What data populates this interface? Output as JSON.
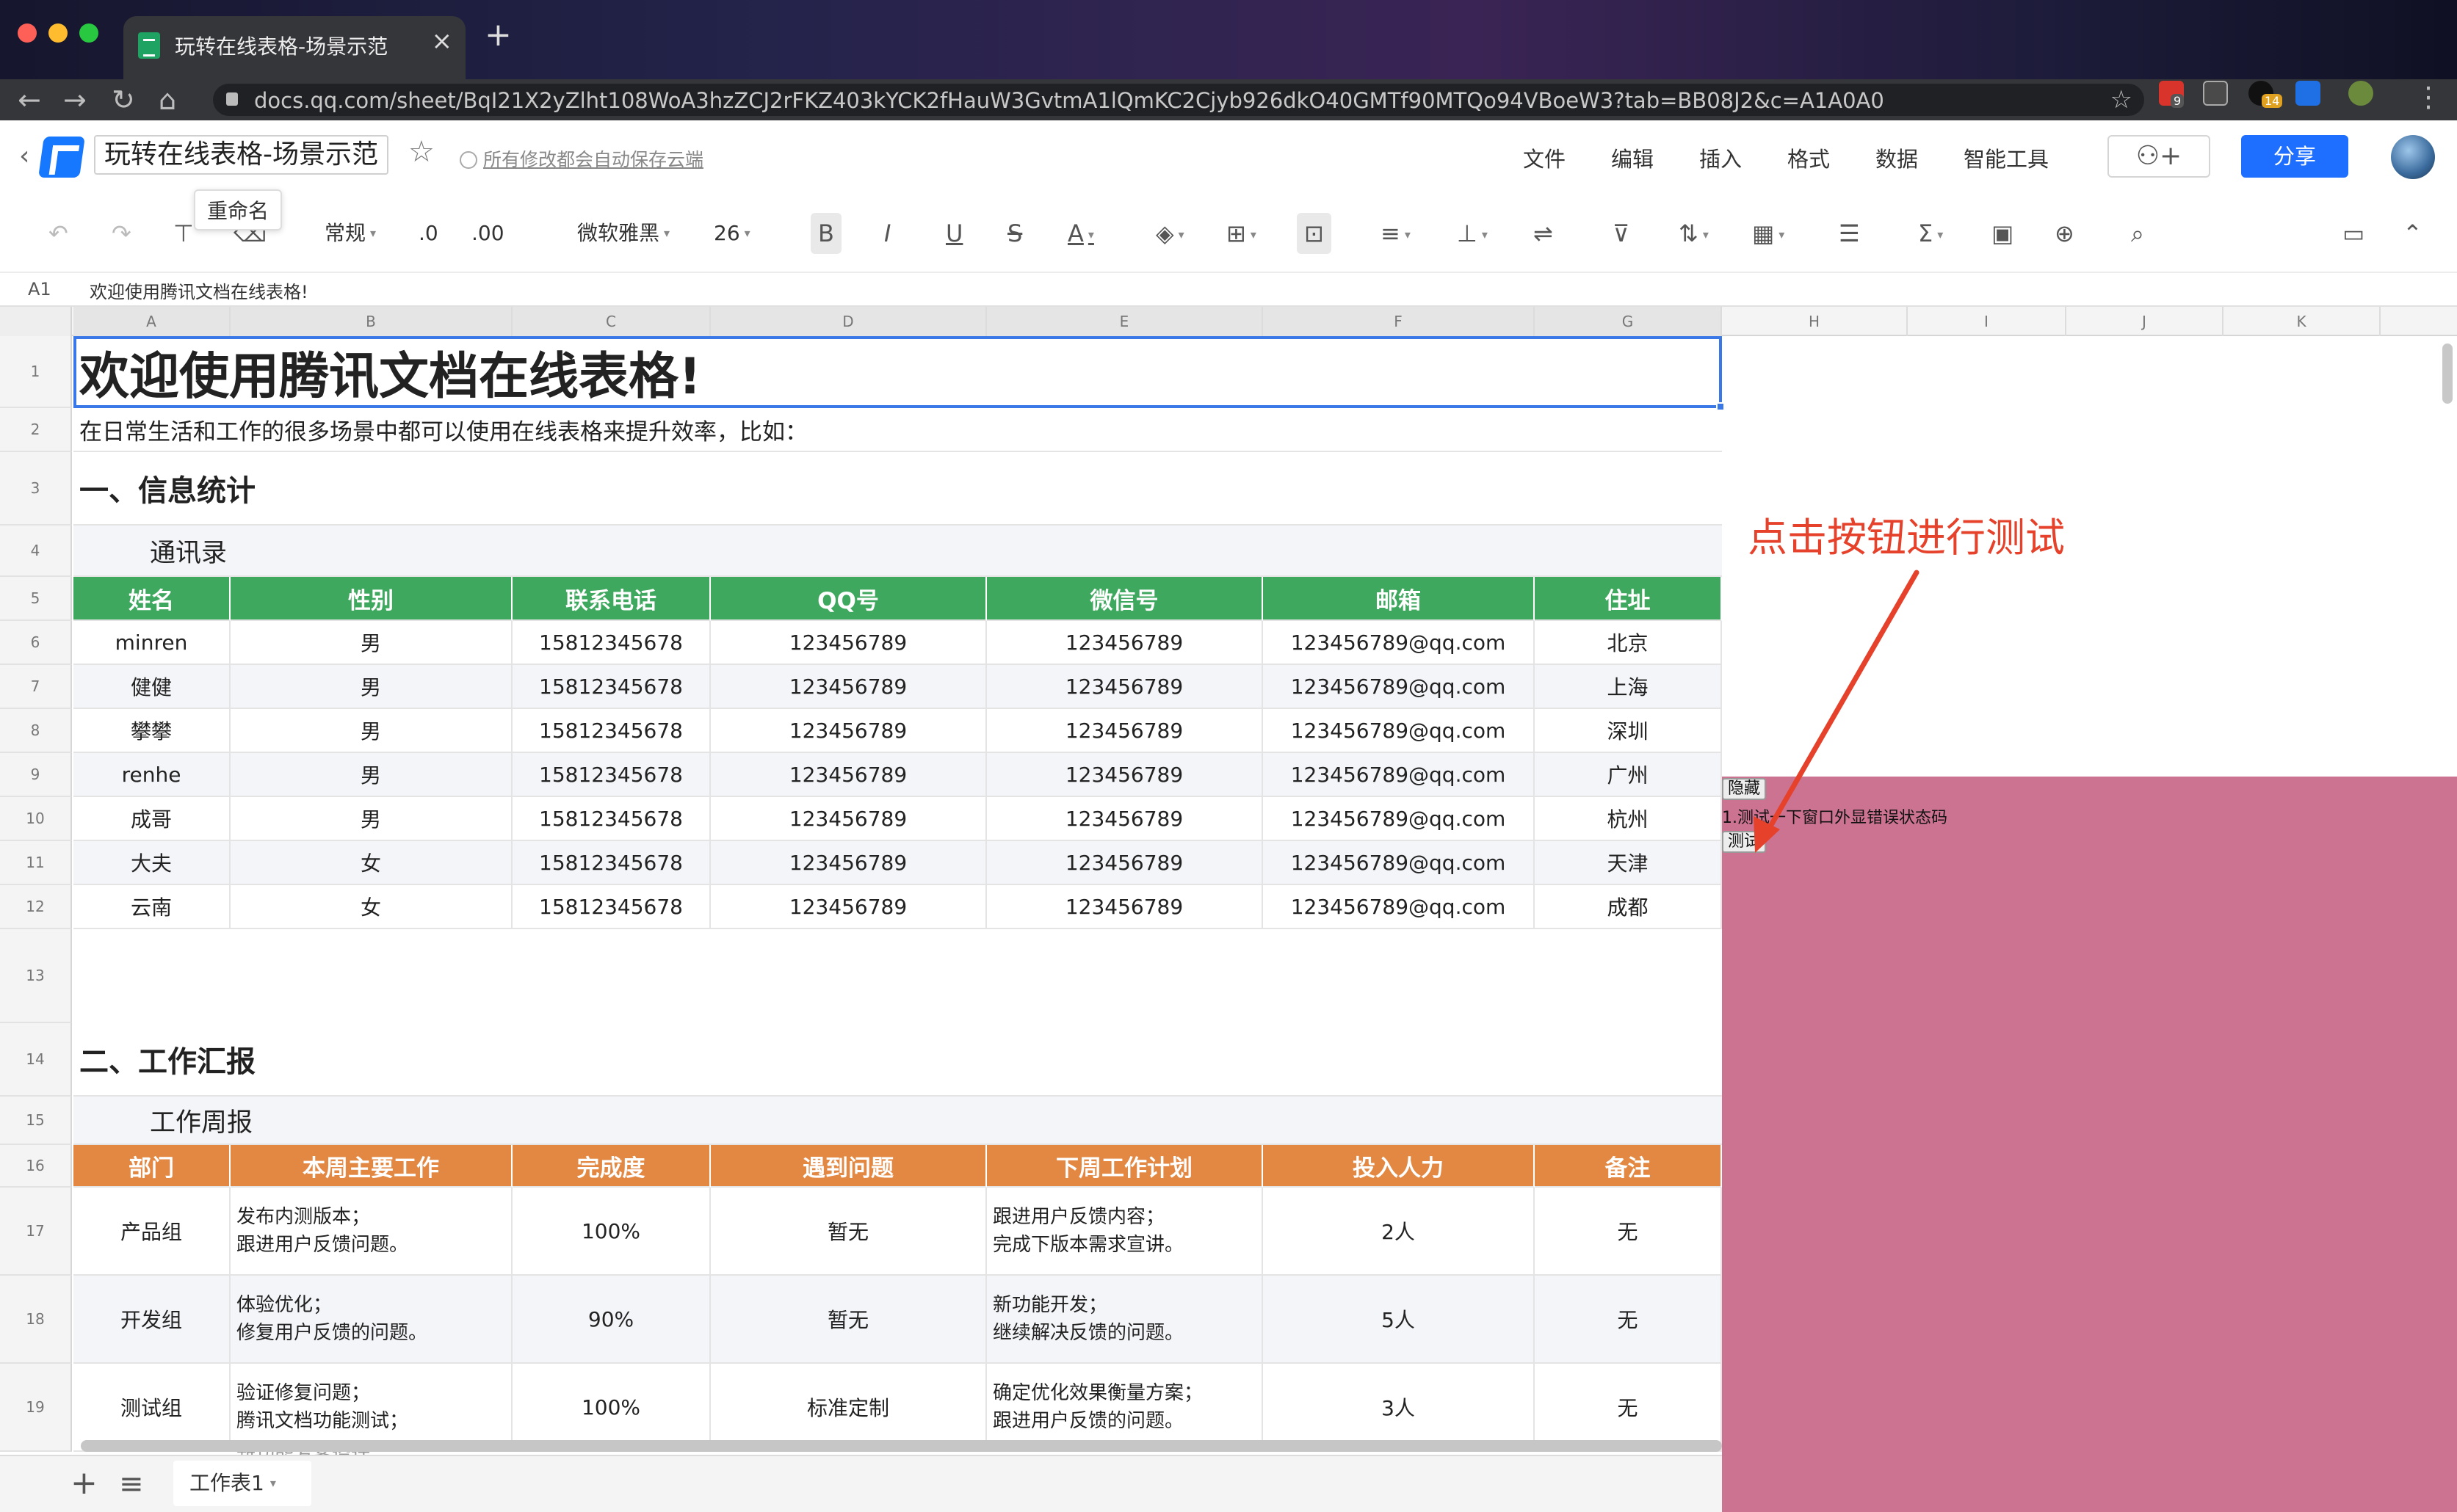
{
  "browser": {
    "tab_title": "玩转在线表格-场景示范",
    "new_tab": "+",
    "url": "docs.qq.com/sheet/BqI21X2yZlht108WoA3hzZCJ2rFKZ403kYCK2fHauW3GvtmA1lQmKC2Cjyb926dkO40GMTf90MTQo94VBoeW3?tab=BB08J2&c=A1A0A0",
    "ext_badges": [
      "9",
      "14"
    ]
  },
  "app": {
    "doc_title": "玩转在线表格-场景示范",
    "save_status": "所有修改都会自动保存云端",
    "tooltip": "重命名",
    "menu": [
      "文件",
      "编辑",
      "插入",
      "格式",
      "数据",
      "智能工具"
    ],
    "share": "分享"
  },
  "toolbar": {
    "number_format": "常规",
    "decrease_decimal": ".0",
    "increase_decimal": ".00",
    "font_family": "微软雅黑",
    "font_size": "26",
    "bold": "B",
    "italic": "I",
    "underline": "U",
    "strike": "S",
    "font_color": "A",
    "sum": "Σ"
  },
  "formula_bar": {
    "cell_ref": "A1",
    "content": "欢迎使用腾讯文档在线表格!"
  },
  "columns": [
    "A",
    "B",
    "C",
    "D",
    "E",
    "F",
    "G",
    "H",
    "I",
    "J",
    "K"
  ],
  "rows": [
    "1",
    "2",
    "3",
    "4",
    "5",
    "6",
    "7",
    "8",
    "9",
    "10",
    "11",
    "12",
    "13",
    "14",
    "15",
    "16",
    "17",
    "18",
    "19"
  ],
  "sheet": {
    "title": "欢迎使用腾讯文档在线表格!",
    "subtitle": "在日常生活和工作的很多场景中都可以使用在线表格来提升效率，比如：",
    "section1": "一、信息统计",
    "table1_caption": "通讯录",
    "table1_headers": [
      "姓名",
      "性别",
      "联系电话",
      "QQ号",
      "微信号",
      "邮箱",
      "住址"
    ],
    "table1_rows": [
      [
        "minren",
        "男",
        "15812345678",
        "123456789",
        "123456789",
        "123456789@qq.com",
        "北京"
      ],
      [
        "健健",
        "男",
        "15812345678",
        "123456789",
        "123456789",
        "123456789@qq.com",
        "上海"
      ],
      [
        "攀攀",
        "男",
        "15812345678",
        "123456789",
        "123456789",
        "123456789@qq.com",
        "深圳"
      ],
      [
        "renhe",
        "男",
        "15812345678",
        "123456789",
        "123456789",
        "123456789@qq.com",
        "广州"
      ],
      [
        "成哥",
        "男",
        "15812345678",
        "123456789",
        "123456789",
        "123456789@qq.com",
        "杭州"
      ],
      [
        "大夫",
        "女",
        "15812345678",
        "123456789",
        "123456789",
        "123456789@qq.com",
        "天津"
      ],
      [
        "云南",
        "女",
        "15812345678",
        "123456789",
        "123456789",
        "123456789@qq.com",
        "成都"
      ]
    ],
    "section2": "二、工作汇报",
    "table2_caption": "工作周报",
    "table2_headers": [
      "部门",
      "本周主要工作",
      "完成度",
      "遇到问题",
      "下周工作计划",
      "投入人力",
      "备注"
    ],
    "table2_rows": [
      [
        "产品组",
        "发布内测版本；",
        "跟进用户反馈问题。",
        "100%",
        "暂无",
        "跟进用户反馈内容；",
        "完成下版本需求宣讲。",
        "2人",
        "无"
      ],
      [
        "开发组",
        "体验优化；",
        "修复用户反馈的问题。",
        "90%",
        "暂无",
        "新功能开发；",
        "继续解决反馈的问题。",
        "5人",
        "无"
      ],
      [
        "测试组",
        "验证修复问题；",
        "腾讯文档功能测试；",
        "100%",
        "标准定制",
        "确定优化效果衡量方案；",
        "跟进用户反馈的问题。",
        "3人",
        "无"
      ]
    ],
    "partial_row": "新功能方案设计；"
  },
  "overlay": {
    "hide_button": "隐藏",
    "status_text": "1.测试一下窗口外显错误状态码",
    "test_button": "测试",
    "annotation": "点击按钮进行测试",
    "annotation_color": "#e5412b",
    "panel_color": "#cc7391"
  },
  "sheet_tabs": {
    "current": "工作表1"
  }
}
